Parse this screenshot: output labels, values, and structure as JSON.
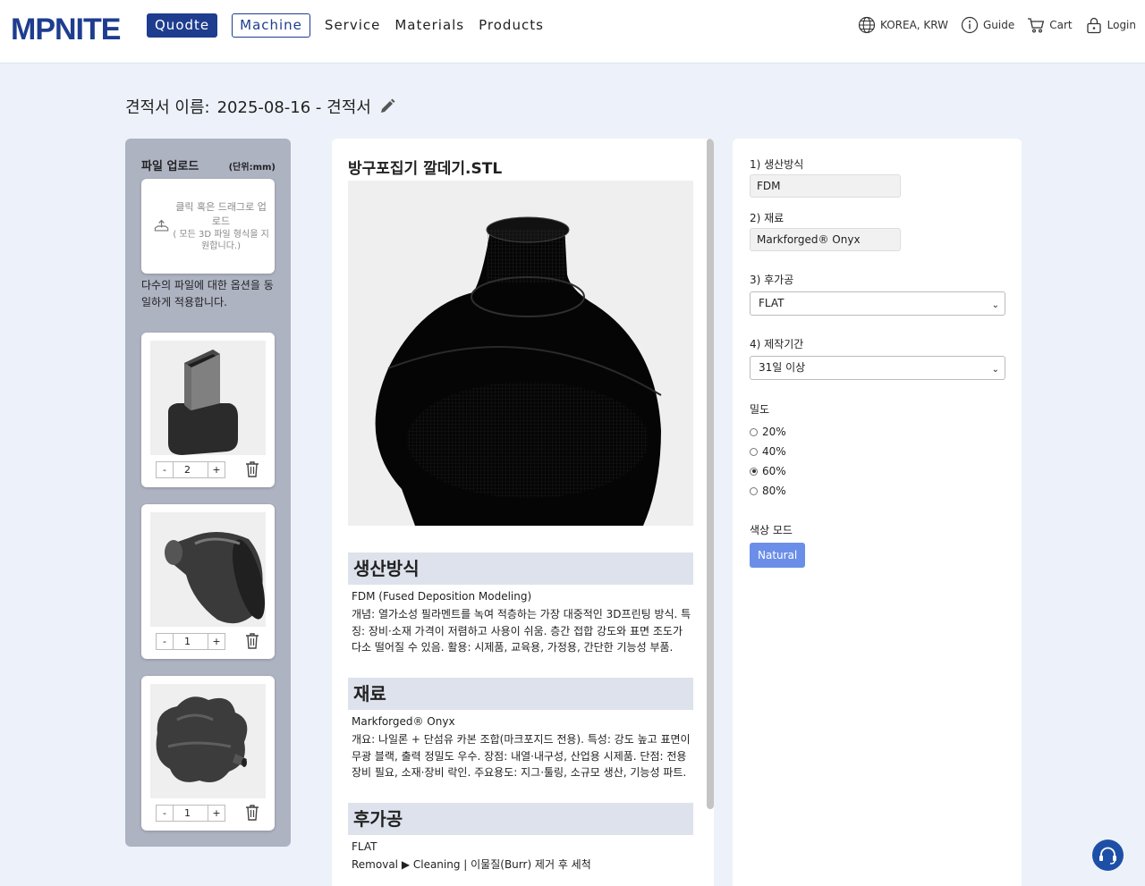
{
  "header": {
    "logo": "MPNITE",
    "nav": {
      "quote": "Quodte",
      "machine": "Machine",
      "service": "Service",
      "materials": "Materials",
      "products": "Products"
    },
    "region": "KOREA, KRW",
    "guide": "Guide",
    "cart": "Cart",
    "login": "Login"
  },
  "quote": {
    "label": "견적서 이름:",
    "name": "2025-08-16 - 견적서"
  },
  "upload": {
    "title": "파일 업로드",
    "unit": "(단위:mm)",
    "drop_text": "클릭 혹은 드래그로 업로드",
    "drop_sub": "( 모든 3D 파일 형식을 지원합니다.)",
    "multi_note": "다수의 파일에 대한 옵션을 동일하게 적용합니다.",
    "files": [
      {
        "qty": "2",
        "minus": "-",
        "plus": "+"
      },
      {
        "qty": "1",
        "minus": "-",
        "plus": "+"
      },
      {
        "qty": "1",
        "minus": "-",
        "plus": "+"
      }
    ]
  },
  "detail": {
    "filename": "방구포집기 깔데기.STL",
    "sections": [
      {
        "title": "생산방식",
        "sub": "FDM (Fused Deposition Modeling)",
        "desc": "개념: 열가소성 필라멘트를 녹여 적층하는 가장 대중적인 3D프린팅 방식. 특징: 장비·소재 가격이 저렴하고 사용이 쉬움. 층간 접합 강도와 표면 조도가 다소 떨어질 수 있음. 활용: 시제품, 교육용, 가정용, 간단한 기능성 부품."
      },
      {
        "title": "재료",
        "sub": "Markforged® Onyx",
        "desc": "개요: 나일론 + 단섬유 카본 조합(마크포지드 전용). 특성: 강도 높고 표면이 무광 블랙, 출력 정밀도 우수. 장점: 내열·내구성, 산업용 시제품. 단점: 전용 장비 필요, 소재·장비 락인. 주요용도: 지그·툴링, 소규모 생산, 기능성 파트."
      },
      {
        "title": "후가공",
        "sub": "FLAT",
        "desc": "Removal ▶ Cleaning  |  이물질(Burr) 제거 후 세척"
      }
    ]
  },
  "options": {
    "method_label": "1) 생산방식",
    "method_value": "FDM",
    "material_label": "2) 재료",
    "material_value": "Markforged® Onyx",
    "post_label": "3) 후가공",
    "post_value": "FLAT",
    "period_label": "4) 제작기간",
    "period_value": "31일 이상",
    "density_label": "밀도",
    "density_options": [
      "20%",
      "40%",
      "60%",
      "80%"
    ],
    "density_selected": "60%",
    "color_label": "색상 모드",
    "color_value": "Natural"
  },
  "colors": {
    "brand": "#1e3d8f",
    "accent": "#6b8fe8",
    "panel": "#aeb3c2",
    "bg": "#edf2fa"
  }
}
